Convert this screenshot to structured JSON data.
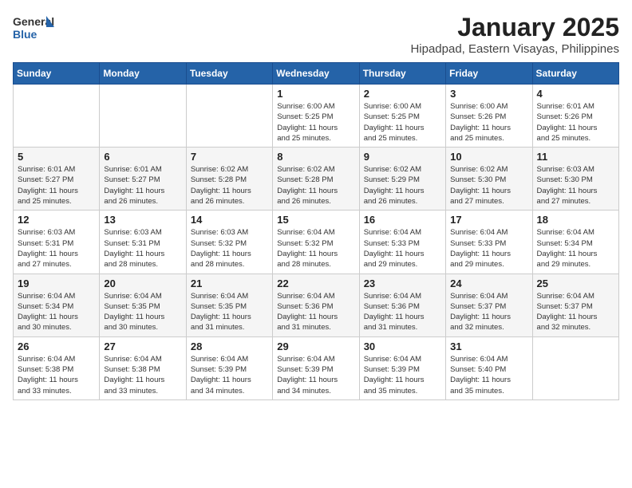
{
  "header": {
    "logo_general": "General",
    "logo_blue": "Blue",
    "title": "January 2025",
    "subtitle": "Hipadpad, Eastern Visayas, Philippines"
  },
  "calendar": {
    "weekdays": [
      "Sunday",
      "Monday",
      "Tuesday",
      "Wednesday",
      "Thursday",
      "Friday",
      "Saturday"
    ],
    "weeks": [
      [
        {
          "day": "",
          "info": ""
        },
        {
          "day": "",
          "info": ""
        },
        {
          "day": "",
          "info": ""
        },
        {
          "day": "1",
          "info": "Sunrise: 6:00 AM\nSunset: 5:25 PM\nDaylight: 11 hours\nand 25 minutes."
        },
        {
          "day": "2",
          "info": "Sunrise: 6:00 AM\nSunset: 5:25 PM\nDaylight: 11 hours\nand 25 minutes."
        },
        {
          "day": "3",
          "info": "Sunrise: 6:00 AM\nSunset: 5:26 PM\nDaylight: 11 hours\nand 25 minutes."
        },
        {
          "day": "4",
          "info": "Sunrise: 6:01 AM\nSunset: 5:26 PM\nDaylight: 11 hours\nand 25 minutes."
        }
      ],
      [
        {
          "day": "5",
          "info": "Sunrise: 6:01 AM\nSunset: 5:27 PM\nDaylight: 11 hours\nand 25 minutes."
        },
        {
          "day": "6",
          "info": "Sunrise: 6:01 AM\nSunset: 5:27 PM\nDaylight: 11 hours\nand 26 minutes."
        },
        {
          "day": "7",
          "info": "Sunrise: 6:02 AM\nSunset: 5:28 PM\nDaylight: 11 hours\nand 26 minutes."
        },
        {
          "day": "8",
          "info": "Sunrise: 6:02 AM\nSunset: 5:28 PM\nDaylight: 11 hours\nand 26 minutes."
        },
        {
          "day": "9",
          "info": "Sunrise: 6:02 AM\nSunset: 5:29 PM\nDaylight: 11 hours\nand 26 minutes."
        },
        {
          "day": "10",
          "info": "Sunrise: 6:02 AM\nSunset: 5:30 PM\nDaylight: 11 hours\nand 27 minutes."
        },
        {
          "day": "11",
          "info": "Sunrise: 6:03 AM\nSunset: 5:30 PM\nDaylight: 11 hours\nand 27 minutes."
        }
      ],
      [
        {
          "day": "12",
          "info": "Sunrise: 6:03 AM\nSunset: 5:31 PM\nDaylight: 11 hours\nand 27 minutes."
        },
        {
          "day": "13",
          "info": "Sunrise: 6:03 AM\nSunset: 5:31 PM\nDaylight: 11 hours\nand 28 minutes."
        },
        {
          "day": "14",
          "info": "Sunrise: 6:03 AM\nSunset: 5:32 PM\nDaylight: 11 hours\nand 28 minutes."
        },
        {
          "day": "15",
          "info": "Sunrise: 6:04 AM\nSunset: 5:32 PM\nDaylight: 11 hours\nand 28 minutes."
        },
        {
          "day": "16",
          "info": "Sunrise: 6:04 AM\nSunset: 5:33 PM\nDaylight: 11 hours\nand 29 minutes."
        },
        {
          "day": "17",
          "info": "Sunrise: 6:04 AM\nSunset: 5:33 PM\nDaylight: 11 hours\nand 29 minutes."
        },
        {
          "day": "18",
          "info": "Sunrise: 6:04 AM\nSunset: 5:34 PM\nDaylight: 11 hours\nand 29 minutes."
        }
      ],
      [
        {
          "day": "19",
          "info": "Sunrise: 6:04 AM\nSunset: 5:34 PM\nDaylight: 11 hours\nand 30 minutes."
        },
        {
          "day": "20",
          "info": "Sunrise: 6:04 AM\nSunset: 5:35 PM\nDaylight: 11 hours\nand 30 minutes."
        },
        {
          "day": "21",
          "info": "Sunrise: 6:04 AM\nSunset: 5:35 PM\nDaylight: 11 hours\nand 31 minutes."
        },
        {
          "day": "22",
          "info": "Sunrise: 6:04 AM\nSunset: 5:36 PM\nDaylight: 11 hours\nand 31 minutes."
        },
        {
          "day": "23",
          "info": "Sunrise: 6:04 AM\nSunset: 5:36 PM\nDaylight: 11 hours\nand 31 minutes."
        },
        {
          "day": "24",
          "info": "Sunrise: 6:04 AM\nSunset: 5:37 PM\nDaylight: 11 hours\nand 32 minutes."
        },
        {
          "day": "25",
          "info": "Sunrise: 6:04 AM\nSunset: 5:37 PM\nDaylight: 11 hours\nand 32 minutes."
        }
      ],
      [
        {
          "day": "26",
          "info": "Sunrise: 6:04 AM\nSunset: 5:38 PM\nDaylight: 11 hours\nand 33 minutes."
        },
        {
          "day": "27",
          "info": "Sunrise: 6:04 AM\nSunset: 5:38 PM\nDaylight: 11 hours\nand 33 minutes."
        },
        {
          "day": "28",
          "info": "Sunrise: 6:04 AM\nSunset: 5:39 PM\nDaylight: 11 hours\nand 34 minutes."
        },
        {
          "day": "29",
          "info": "Sunrise: 6:04 AM\nSunset: 5:39 PM\nDaylight: 11 hours\nand 34 minutes."
        },
        {
          "day": "30",
          "info": "Sunrise: 6:04 AM\nSunset: 5:39 PM\nDaylight: 11 hours\nand 35 minutes."
        },
        {
          "day": "31",
          "info": "Sunrise: 6:04 AM\nSunset: 5:40 PM\nDaylight: 11 hours\nand 35 minutes."
        },
        {
          "day": "",
          "info": ""
        }
      ]
    ]
  }
}
